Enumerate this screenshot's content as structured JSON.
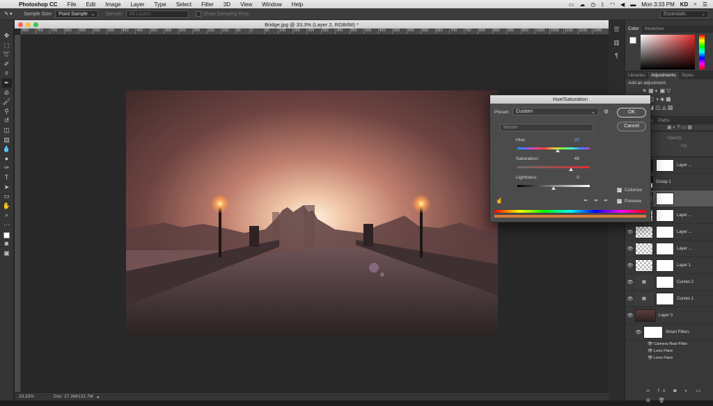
{
  "menubar": {
    "app_name": "Photoshop CC",
    "items": [
      "File",
      "Edit",
      "Image",
      "Layer",
      "Type",
      "Select",
      "Filter",
      "3D",
      "View",
      "Window",
      "Help"
    ],
    "clock": "Mon 3:33 PM",
    "user": "KD"
  },
  "options": {
    "sample_size_label": "Sample Size:",
    "sample_size_value": "Point Sample",
    "sample_label": "Sample:",
    "sample_value": "All Layers",
    "show_ring_label": "Show Sampling Ring",
    "workspace": "Essentials"
  },
  "document": {
    "title": "Bridge.jpg @ 33.3% (Layer 2, RGB/8#) *",
    "ruler_ticks": [
      "800",
      "750",
      "700",
      "650",
      "600",
      "550",
      "500",
      "450",
      "400",
      "350",
      "300",
      "250",
      "200",
      "150",
      "100",
      "50",
      "0",
      "50",
      "100",
      "150",
      "200",
      "250",
      "300",
      "350",
      "400",
      "450",
      "500",
      "550",
      "600",
      "650",
      "700",
      "750",
      "800",
      "850",
      "900",
      "950",
      "1000",
      "1050",
      "1100",
      "1150",
      "1200"
    ],
    "zoom": "33.33%",
    "doc_info": "Doc: 17.2M/131.7M"
  },
  "panels": {
    "color_tabs": [
      "Color",
      "Swatches"
    ],
    "adjust_tabs": [
      "Libraries",
      "Adjustments",
      "Styles"
    ],
    "add_adjustment": "Add an adjustment",
    "layers_tabs": [
      "Channels",
      "Paths"
    ],
    "opacity_label": "Opacity:",
    "fill_label": "Fill:",
    "layers": [
      {
        "name": "Layer ..."
      },
      {
        "name": "Group 1"
      },
      {
        "name": ""
      },
      {
        "name": "Layer ..."
      },
      {
        "name": "Layer ..."
      },
      {
        "name": "Layer ..."
      },
      {
        "name": "Layer 1"
      },
      {
        "name": "Curves 2"
      },
      {
        "name": "Curves 1"
      },
      {
        "name": "Layer 0"
      },
      {
        "name": "Smart Filters"
      }
    ],
    "filters": [
      "Camera Raw Filter",
      "Lens Flare",
      "Lens Flare"
    ]
  },
  "dialog": {
    "title": "Hue/Saturation",
    "preset_label": "Preset:",
    "preset_value": "Custom",
    "channel_value": "Master",
    "ok": "OK",
    "cancel": "Cancel",
    "hue_label": "Hue:",
    "hue_value": "20",
    "saturation_label": "Saturation:",
    "saturation_value": "49",
    "lightness_label": "Lightness:",
    "lightness_value": "0",
    "colorize_label": "Colorize",
    "preview_label": "Preview",
    "colorize_checked": true,
    "preview_checked": true,
    "hue_fraction": 0.556,
    "saturation_fraction": 0.745,
    "lightness_fraction": 0.5
  }
}
